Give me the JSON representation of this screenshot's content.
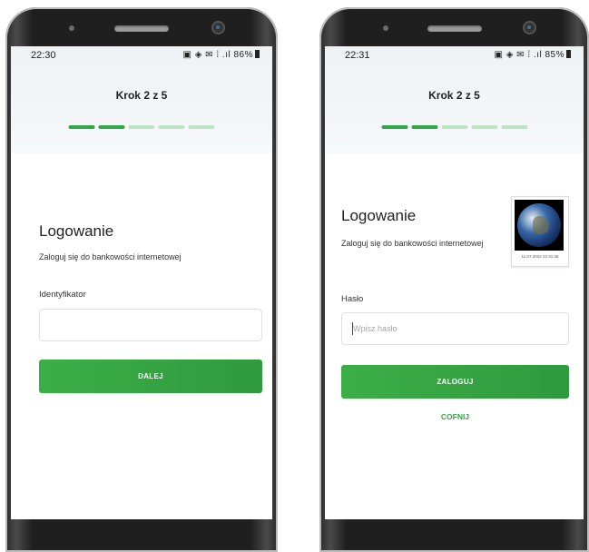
{
  "screens": [
    {
      "status_time": "22:30",
      "status_icons": "▣ ◈ ✉ ⁞ .ıl 86%",
      "step_title": "Krok 2 z 5",
      "progress_done": 2,
      "progress_total": 5,
      "heading": "Logowanie",
      "subtitle": "Zaloguj się do bankowości internetowej",
      "field_label": "Identyfikator",
      "input_value": "",
      "input_placeholder": "",
      "button_label": "DALEJ"
    },
    {
      "status_time": "22:31",
      "status_icons": "▣ ◈ ✉ ⁞ .ıl 85%",
      "step_title": "Krok 2 z 5",
      "progress_done": 2,
      "progress_total": 5,
      "heading": "Logowanie",
      "subtitle": "Zaloguj się do bankowości internetowej",
      "field_label": "Hasło",
      "input_value": "",
      "input_placeholder": "Wpisz hasło",
      "button_label": "ZALOGUJ",
      "link_label": "COFNIJ",
      "photo_timestamp": "11.07.2022 22:31:36",
      "photo_icon": "earth-photo"
    }
  ],
  "colors": {
    "accent": "#2fa74a",
    "progress_inactive": "#bfe3c4",
    "header_bg": "#eef2f5"
  }
}
